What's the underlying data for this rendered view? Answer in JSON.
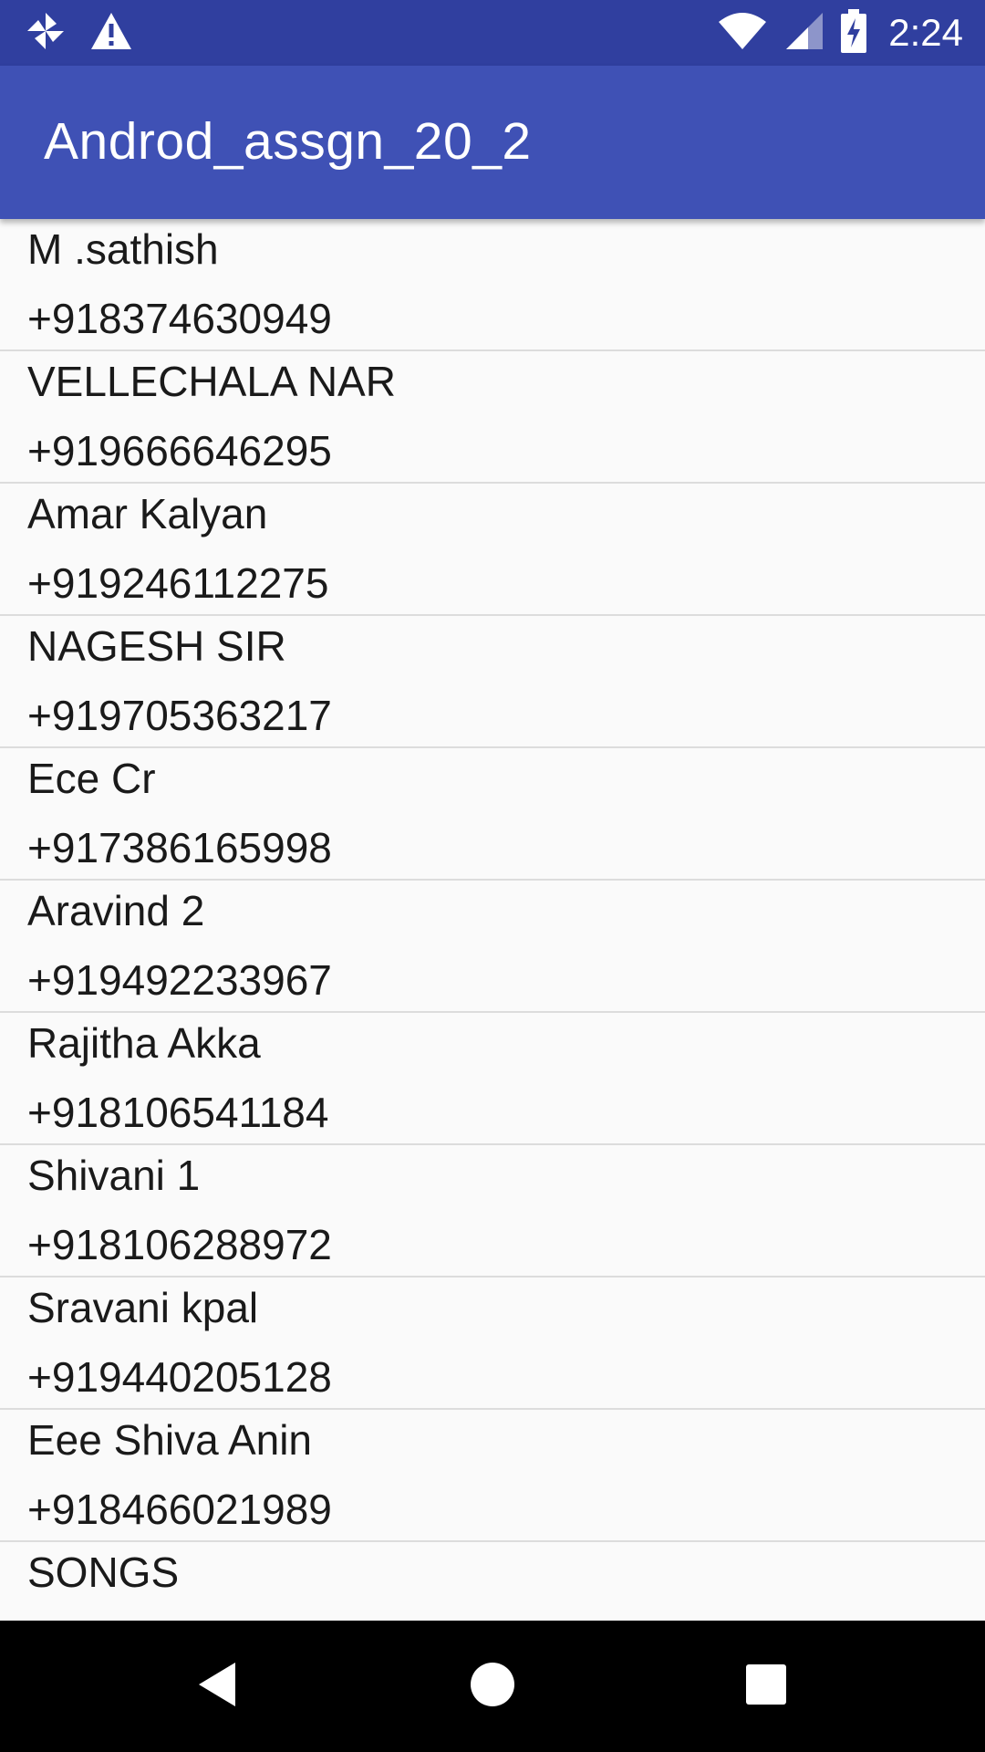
{
  "status_bar": {
    "time": "2:24",
    "icons": [
      "pinwheel-icon",
      "warning-icon",
      "wifi-icon",
      "cell-signal-icon",
      "battery-charging-icon"
    ]
  },
  "app_bar": {
    "title": "Androd_assgn_20_2"
  },
  "contacts": [
    {
      "name": "M .sathish",
      "phone": "+918374630949"
    },
    {
      "name": "VELLECHALA NAR",
      "phone": "+919666646295"
    },
    {
      "name": "Amar Kalyan",
      "phone": "+919246112275"
    },
    {
      "name": "NAGESH SIR",
      "phone": "+919705363217"
    },
    {
      "name": "Ece Cr",
      "phone": "+917386165998"
    },
    {
      "name": "Aravind 2",
      "phone": "+919492233967"
    },
    {
      "name": "Rajitha Akka",
      "phone": "+918106541184"
    },
    {
      "name": "Shivani 1",
      "phone": "+918106288972"
    },
    {
      "name": "Sravani kpal",
      "phone": "+919440205128"
    },
    {
      "name": "Eee Shiva Anin",
      "phone": "+918466021989"
    },
    {
      "name": "SONGS",
      "phone": ""
    }
  ],
  "nav_bar": {
    "buttons": [
      "back-icon",
      "home-icon",
      "recents-icon"
    ]
  },
  "colors": {
    "status_bar": "#303f9f",
    "app_bar": "#3f51b5",
    "list_background": "#fafafa",
    "divider": "#dcdcdc",
    "nav_bar": "#000000"
  }
}
